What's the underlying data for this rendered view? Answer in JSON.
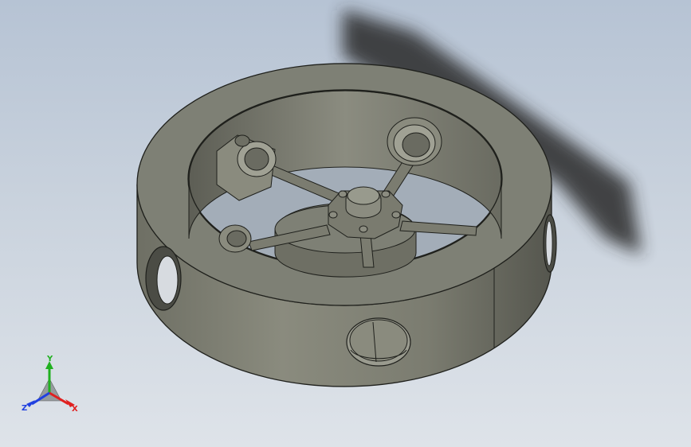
{
  "triad": {
    "x_label": "X",
    "y_label": "Y",
    "z_label": "Z"
  },
  "colors": {
    "background_top": "#b6c3d4",
    "background_bottom": "#dee3e9",
    "part_top_face": "#7e8075",
    "part_side_face": "#868779",
    "part_dark_face": "#56574f",
    "edge": "#1f201c",
    "shadow": "#2a2c2a",
    "axis_x": "#e02020",
    "axis_y": "#20b020",
    "axis_z": "#2040e0"
  }
}
